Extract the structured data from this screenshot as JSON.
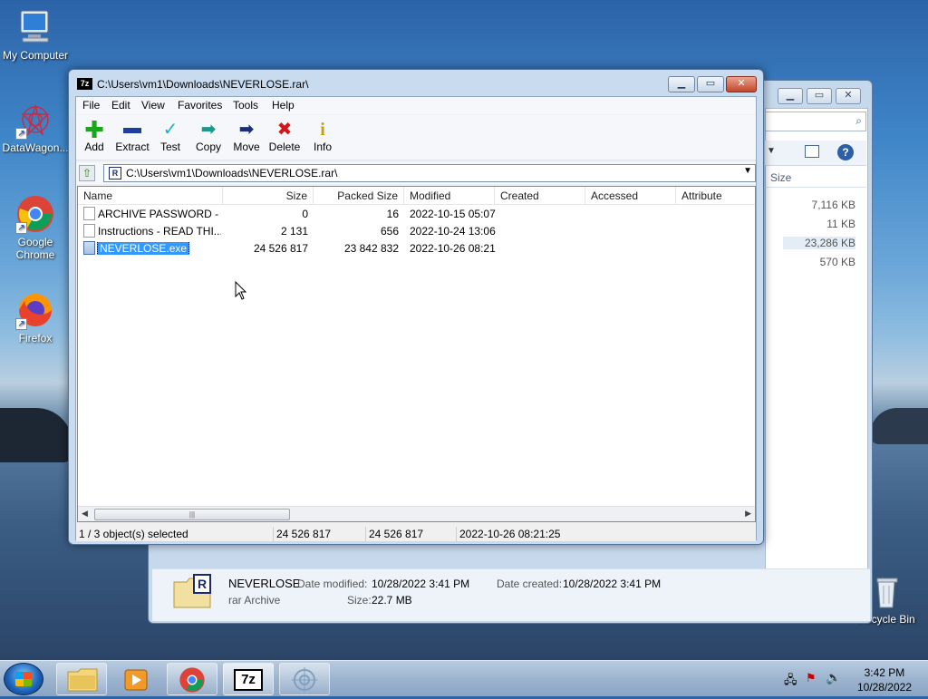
{
  "desktop": {
    "icons": [
      {
        "label": "My Computer"
      },
      {
        "label": "DataWagon..."
      },
      {
        "label": "Google Chrome"
      },
      {
        "label": "Firefox"
      },
      {
        "label": "Recycle Bin"
      }
    ]
  },
  "bg_explorer": {
    "size_header": "Size",
    "sizes": [
      "7,116 KB",
      "11 KB",
      "23,286 KB",
      "570 KB"
    ],
    "details": {
      "name": "NEVERLOSE",
      "type": "rar Archive",
      "date_modified_label": "Date modified:",
      "date_modified": "10/28/2022 3:41 PM",
      "size_label": "Size:",
      "size": "22.7 MB",
      "date_created_label": "Date created:",
      "date_created": "10/28/2022 3:41 PM"
    }
  },
  "window": {
    "icon_text": "7z",
    "title": "C:\\Users\\vm1\\Downloads\\NEVERLOSE.rar\\",
    "menu": [
      "File",
      "Edit",
      "View",
      "Favorites",
      "Tools",
      "Help"
    ],
    "toolbar": [
      {
        "label": "Add",
        "icon": "plus-icon",
        "color": "#1aa51a"
      },
      {
        "label": "Extract",
        "icon": "minus-icon",
        "color": "#1c3fa0"
      },
      {
        "label": "Test",
        "icon": "check-icon",
        "color": "#1ab3c8"
      },
      {
        "label": "Copy",
        "icon": "copy-arrow-icon",
        "color": "#1a9a8a"
      },
      {
        "label": "Move",
        "icon": "move-arrow-icon",
        "color": "#1a2f7a"
      },
      {
        "label": "Delete",
        "icon": "delete-x-icon",
        "color": "#d01818"
      },
      {
        "label": "Info",
        "icon": "info-icon",
        "color": "#c8a000"
      }
    ],
    "address": "C:\\Users\\vm1\\Downloads\\NEVERLOSE.rar\\",
    "columns": [
      "Name",
      "Size",
      "Packed Size",
      "Modified",
      "Created",
      "Accessed",
      "Attribute"
    ],
    "rows": [
      {
        "name": "ARCHIVE PASSWORD - ...",
        "size": "0",
        "packed": "16",
        "modified": "2022-10-15 05:07",
        "selected": false
      },
      {
        "name": "Instructions - READ THI...",
        "size": "2 131",
        "packed": "656",
        "modified": "2022-10-24 13:06",
        "selected": false
      },
      {
        "name": "NEVERLOSE.exe",
        "size": "24 526 817",
        "packed": "23 842 832",
        "modified": "2022-10-26 08:21",
        "selected": true
      }
    ],
    "status": {
      "selection": "1 / 3 object(s) selected",
      "size": "24 526 817",
      "packed": "24 526 817",
      "modified": "2022-10-26 08:21:25"
    }
  },
  "taskbar": {
    "time": "3:42 PM",
    "date": "10/28/2022",
    "items": [
      "explorer",
      "media-player",
      "chrome",
      "7zip",
      "app"
    ]
  }
}
